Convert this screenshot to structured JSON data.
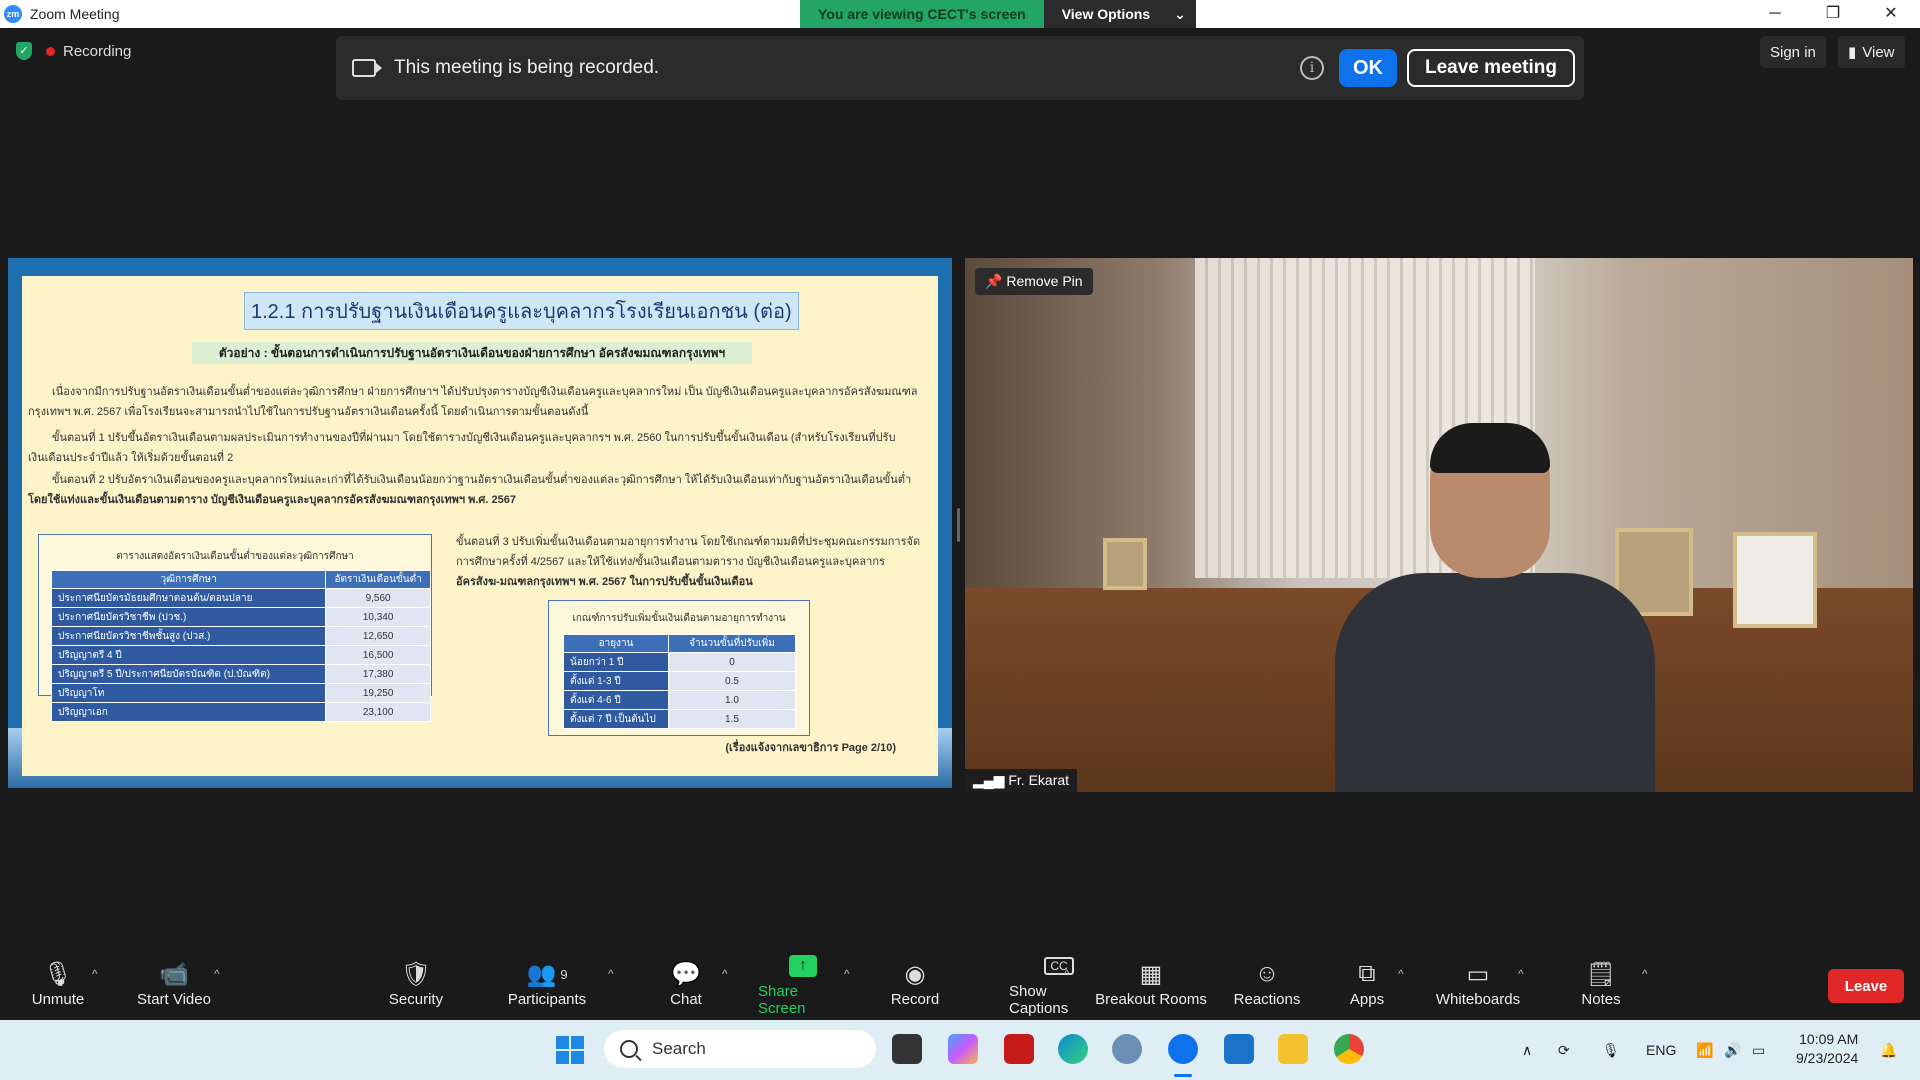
{
  "window": {
    "title": "Zoom Meeting",
    "viewing_banner": "You are viewing CECT's screen",
    "view_options": "View Options"
  },
  "status": {
    "recording_label": "Recording"
  },
  "recording_banner": {
    "message": "This meeting is being recorded.",
    "ok": "OK",
    "leave": "Leave meeting"
  },
  "header": {
    "sign_in": "Sign in",
    "view": "View"
  },
  "slide": {
    "title": "1.2.1  การปรับฐานเงินเดือนครูและบุคลากรโรงเรียนเอกชน (ต่อ)",
    "subtitle": "ตัวอย่าง : ขั้นตอนการดำเนินการปรับฐานอัตราเงินเดือนของฝ่ายการศึกษา อัครสังฆมณฑลกรุงเทพฯ",
    "para1": "เนื่องจากมีการปรับฐานอัตราเงินเดือนขั้นต่ำของแต่ละวุฒิการศึกษา ฝ่ายการศึกษาฯ ได้ปรับปรุงตารางบัญชีเงินเดือนครูและบุคลากรใหม่ เป็น บัญชีเงินเดือนครูและบุคลากรอัครสังฆมณฑล",
    "para1b": "กรุงเทพฯ พ.ศ. 2567 เพื่อโรงเรียนจะสามารถนำไปใช้ในการปรับฐานอัตราเงินเดือนครั้งนี้ โดยดำเนินการตามขั้นตอนดังนี้",
    "step1": "ขั้นตอนที่ 1  ปรับขึ้นอัตราเงินเดือนตามผลประเมินการทำงานของปีที่ผ่านมา โดยใช้ตารางบัญชีเงินเดือนครูและบุคลากรฯ พ.ศ. 2560 ในการปรับขึ้นขั้นเงินเดือน (สำหรับโรงเรียนที่ปรับ",
    "step1b": "เงินเดือนประจำปีแล้ว ให้เริ่มด้วยขั้นตอนที่ 2",
    "step2": "ขั้นตอนที่ 2  ปรับอัตราเงินเดือนของครูและบุคลากรใหม่และเก่าที่ได้รับเงินเดือนน้อยกว่าฐานอัตราเงินเดือนขั้นต่ำของแต่ละวุฒิการศึกษา ให้ได้รับเงินเดือนเท่ากับฐานอัตราเงินเดือนขั้นต่ำ",
    "step2b": "โดยใช้แท่งและขั้นเงินเดือนตามตาราง บัญชีเงินเดือนครูและบุคลากรอัครสังฆมณฑลกรุงเทพฯ พ.ศ. 2567",
    "step3a": "ขั้นตอนที่ 3  ปรับเพิ่มขั้นเงินเดือนตามอายุการทำงาน โดยใช้เกณฑ์ตามมติที่ประชุมคณะกรรมการจัด",
    "step3b": "การศึกษาครั้งที่ 4/2567 และให้ใช้แท่ง/ขั้นเงินเดือนตามตาราง บัญชีเงินเดือนครูและบุคลากร",
    "step3c": "อัครสังฆ-มณฑลกรุงเทพฯ พ.ศ. 2567 ในการปรับขึ้นขั้นเงินเดือน",
    "footer": "(เรื่องแจ้งจากเลขาธิการ Page 2/10)",
    "table1": {
      "caption": "ตารางแสดงอัตราเงินเดือนขั้นต่ำของแต่ละวุฒิการศึกษา",
      "headers": [
        "วุฒิการศึกษา",
        "อัตราเงินเดือนขั้นต่ำ"
      ],
      "rows": [
        [
          "ประกาศนียบัตรมัธยมศึกษาตอนต้น/ตอนปลาย",
          "9,560"
        ],
        [
          "ประกาศนียบัตรวิชาชีพ (ปวช.)",
          "10,340"
        ],
        [
          "ประกาศนียบัตรวิชาชีพชั้นสูง (ปวส.)",
          "12,650"
        ],
        [
          "ปริญญาตรี 4 ปี",
          "16,500"
        ],
        [
          "ปริญญาตรี 5 ปี/ประกาศนียบัตรบัณฑิต (ป.บัณฑิต)",
          "17,380"
        ],
        [
          "ปริญญาโท",
          "19,250"
        ],
        [
          "ปริญญาเอก",
          "23,100"
        ]
      ]
    },
    "table2": {
      "caption": "เกณฑ์การปรับเพิ่มขั้นเงินเดือนตามอายุการทำงาน",
      "headers": [
        "อายุงาน",
        "จำนวนขั้นที่ปรับเพิ่ม"
      ],
      "rows": [
        [
          "น้อยกว่า 1 ปี",
          "0"
        ],
        [
          "ตั้งแต่ 1-3 ปี",
          "0.5"
        ],
        [
          "ตั้งแต่ 4-6 ปี",
          "1.0"
        ],
        [
          "ตั้งแต่ 7 ปี เป็นต้นไป",
          "1.5"
        ]
      ]
    }
  },
  "video": {
    "remove_pin": "Remove Pin",
    "participant_name": "Fr. Ekarat"
  },
  "toolbar": {
    "unmute": "Unmute",
    "start_video": "Start Video",
    "security": "Security",
    "participants": "Participants",
    "participants_count": "9",
    "chat": "Chat",
    "share_screen": "Share Screen",
    "record": "Record",
    "show_captions": "Show Captions",
    "captions_icon_text": "CC",
    "breakout_rooms": "Breakout Rooms",
    "reactions": "Reactions",
    "apps": "Apps",
    "whiteboards": "Whiteboards",
    "notes": "Notes",
    "leave": "Leave"
  },
  "taskbar": {
    "search_placeholder": "Search",
    "language": "ENG",
    "time": "10:09 AM",
    "date": "9/23/2024"
  },
  "colors": {
    "zoom_blue": "#0e72ed",
    "share_green": "#23d160",
    "leave_red": "#e02828",
    "viewing_green": "#23a565"
  }
}
